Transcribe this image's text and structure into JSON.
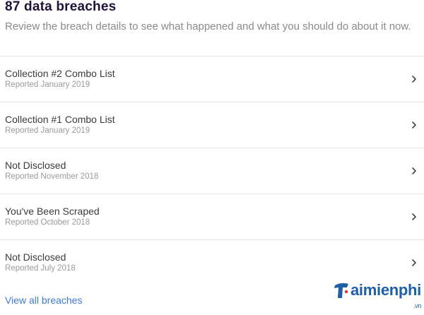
{
  "header": {
    "title": "87 data breaches",
    "subtitle": "Review the breach details to see what happened and what you should do about it now."
  },
  "breaches": [
    {
      "name": "Collection #2 Combo List",
      "reported": "Reported January 2019"
    },
    {
      "name": "Collection #1 Combo List",
      "reported": "Reported January 2019"
    },
    {
      "name": "Not Disclosed",
      "reported": "Reported November 2018"
    },
    {
      "name": "You've Been Scraped",
      "reported": "Reported October 2018"
    },
    {
      "name": "Not Disclosed",
      "reported": "Reported July 2018"
    }
  ],
  "footer": {
    "view_all_label": "View all breaches"
  },
  "watermark": {
    "brand": "aimienphi",
    "tld": ".vn"
  },
  "icons": {
    "row_action": "chevron-right-icon",
    "watermark_logo": "taimienphi-logo-icon"
  },
  "colors": {
    "title": "#20123a",
    "link": "#3d7bd6",
    "watermark": "#1f5fa8"
  }
}
